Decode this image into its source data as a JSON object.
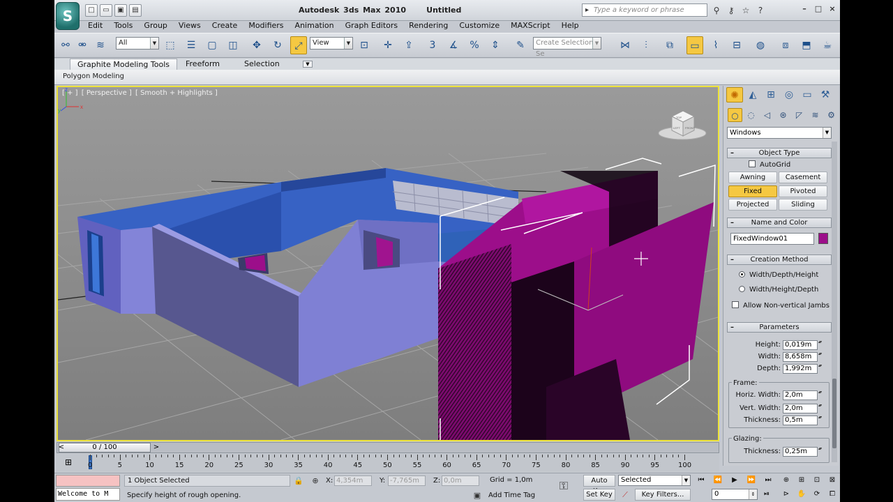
{
  "title_bar": {
    "app_name": "Autodesk 3ds Max  2010",
    "document": "Untitled",
    "search_placeholder": "Type a keyword or phrase",
    "quick_access_icons": [
      "new-file-icon",
      "open-file-icon",
      "save-icon",
      "project-folder-icon"
    ],
    "info_icons": [
      "binoculars-icon",
      "key-icon",
      "star-icon",
      "help-icon"
    ]
  },
  "menu": [
    "Edit",
    "Tools",
    "Group",
    "Views",
    "Create",
    "Modifiers",
    "Animation",
    "Graph Editors",
    "Rendering",
    "Customize",
    "MAXScript",
    "Help"
  ],
  "toolbar": {
    "selection_filter": "All",
    "reference_coord": "View",
    "named_selection_placeholder": "Create Selection Se"
  },
  "ribbon": {
    "tabs": [
      "Graphite Modeling Tools",
      "Freeform",
      "Selection"
    ],
    "panel_label": "Polygon Modeling"
  },
  "viewport": {
    "label_parts": [
      "[ + ]",
      "[ Perspective ]",
      "[ Smooth + Highlights ]"
    ],
    "viewcube_labels": [
      "TOP",
      "LEFT",
      "FRONT"
    ],
    "axis_labels": [
      "x",
      "y",
      "z"
    ],
    "colors": {
      "walls_blue": "#2f62b8",
      "walls_lavender": "#7f7fd6",
      "window_magenta": "#9c0e8a",
      "ground": "#8c8c8c"
    }
  },
  "command_panel": {
    "category": "Windows",
    "object_type": {
      "header": "Object Type",
      "autogrid_label": "AutoGrid",
      "buttons": [
        "Awning",
        "Casement",
        "Fixed",
        "Pivoted",
        "Projected",
        "Sliding"
      ],
      "active": "Fixed"
    },
    "name_and_color": {
      "header": "Name and Color",
      "name": "FixedWindow01",
      "color": "#9c0e8a"
    },
    "creation_method": {
      "header": "Creation Method",
      "options": [
        "Width/Depth/Height",
        "Width/Height/Depth"
      ],
      "selected": "Width/Depth/Height",
      "jambs_label": "Allow Non-vertical Jambs"
    },
    "parameters": {
      "header": "Parameters",
      "height_label": "Height:",
      "height": "0,019m",
      "width_label": "Width:",
      "width": "8,658m",
      "depth_label": "Depth:",
      "depth": "1,992m",
      "frame_label": "Frame:",
      "horiz_label": "Horiz. Width:",
      "horiz": "2,0m",
      "vert_label": "Vert. Width:",
      "vert": "2,0m",
      "thickness_label": "Thickness:",
      "thickness": "0,5m",
      "glazing_label": "Glazing:",
      "glazing_thickness_label": "Thickness:",
      "glazing_thickness": "0,25m"
    }
  },
  "timeline": {
    "frame_display": "0 / 100",
    "ticks": [
      "0",
      "5",
      "10",
      "15",
      "20",
      "25",
      "30",
      "35",
      "40",
      "45",
      "50",
      "55",
      "60",
      "65",
      "70",
      "75",
      "80",
      "85",
      "90",
      "95",
      "100"
    ]
  },
  "status": {
    "maxscript_listener": "Welcome to M",
    "selection_count": "1 Object Selected",
    "prompt": "Specify height of rough opening.",
    "x_label": "X:",
    "x_value": "4,354m",
    "y_label": "Y:",
    "y_value": "-7,765m",
    "z_label": "Z:",
    "z_value": "0,0m",
    "grid": "Grid = 1,0m",
    "add_time_tag": "Add Time Tag",
    "auto_key": "Auto Key",
    "set_key": "Set Key",
    "key_mode": "Selected",
    "key_filters": "Key Filters...",
    "current_frame": "0"
  }
}
